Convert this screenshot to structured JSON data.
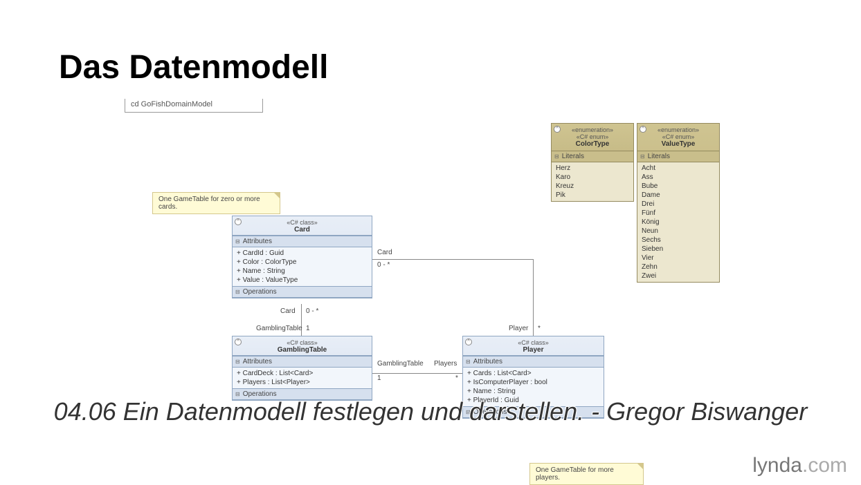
{
  "title": "Das Datenmodell",
  "diagram_tab": "cd GoFishDomainModel",
  "notes": {
    "note1": "One GameTable for zero or more cards.",
    "note2": "One GameTable for more players."
  },
  "classes": {
    "card": {
      "stereotype": "«C# class»",
      "name": "Card",
      "attributes_label": "Attributes",
      "attributes": [
        "+ CardId : Guid",
        "+ Color : ColorType",
        "+ Name : String",
        "+ Value : ValueType"
      ],
      "operations_label": "Operations"
    },
    "gamblingTable": {
      "stereotype": "«C# class»",
      "name": "GamblingTable",
      "attributes_label": "Attributes",
      "attributes": [
        "+ CardDeck : List<Card>",
        "+ Players : List<Player>"
      ],
      "operations_label": "Operations"
    },
    "player": {
      "stereotype": "«C# class»",
      "name": "Player",
      "attributes_label": "Attributes",
      "attributes": [
        "+ Cards : List<Card>",
        "+ IsComputerPlayer : bool",
        "+ Name : String",
        "+ PlayerId : Guid"
      ],
      "operations_label": "Operations"
    }
  },
  "enums": {
    "colorType": {
      "stereotype1": "«enumeration»",
      "stereotype2": "«C# enum»",
      "name": "ColorType",
      "literals_label": "Literals",
      "literals": [
        "Herz",
        "Karo",
        "Kreuz",
        "Pik"
      ]
    },
    "valueType": {
      "stereotype1": "«enumeration»",
      "stereotype2": "«C# enum»",
      "name": "ValueType",
      "literals_label": "Literals",
      "literals": [
        "Acht",
        "Ass",
        "Bube",
        "Dame",
        "Drei",
        "Fünf",
        "König",
        "Neun",
        "Sechs",
        "Sieben",
        "Vier",
        "Zehn",
        "Zwei"
      ]
    }
  },
  "associations": {
    "card_gambling": {
      "role1": "Card",
      "mult1": "0 - *",
      "role2": "GamblingTable",
      "mult2": "1"
    },
    "card_player": {
      "role1": "Card",
      "mult1": "0 - *",
      "role2": "Player",
      "mult2": "*"
    },
    "gambling_player": {
      "role1": "GamblingTable",
      "mult1": "1",
      "role2": "Players",
      "mult2": "*"
    }
  },
  "subtitle": "04.06 Ein Datenmodell festlegen und darstellen. - Gregor Biswanger",
  "brand_part1": "lynda",
  "brand_part2": ".com"
}
